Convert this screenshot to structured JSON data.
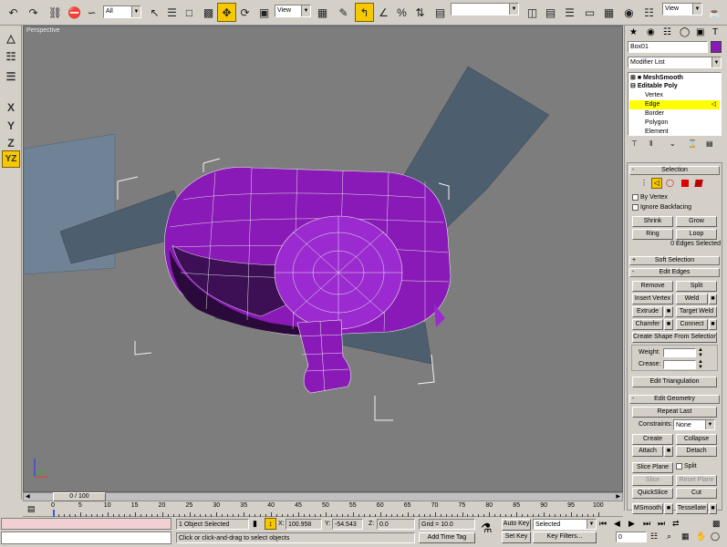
{
  "toolbar": {
    "selection_filter": "All",
    "ref_coord": "View",
    "named_selection": "",
    "view_dropdown": "View"
  },
  "viewport": {
    "label": "Perspective"
  },
  "left_toolbar": {
    "x_label": "X",
    "y_label": "Y",
    "z_label": "Z",
    "yz_label": "YZ"
  },
  "panel": {
    "object_name": "Box01",
    "object_color": "#8a1ab8",
    "modifier_list": "Modifier List",
    "stack": {
      "meshsmooth": "MeshSmooth",
      "editable_poly": "Editable Poly",
      "subs": [
        "Vertex",
        "Edge",
        "Border",
        "Polygon",
        "Element"
      ],
      "selected_sub": "Edge"
    },
    "selection": {
      "title": "Selection",
      "by_vertex": "By Vertex",
      "ignore_backfacing": "Ignore Backfacing",
      "shrink": "Shrink",
      "grow": "Grow",
      "ring": "Ring",
      "loop": "Loop",
      "status": "0 Edges Selected"
    },
    "soft_selection": "Soft Selection",
    "edit_edges": {
      "title": "Edit Edges",
      "remove": "Remove",
      "split": "Split",
      "insert_vertex": "Insert Vertex",
      "weld": "Weld",
      "extrude": "Extrude",
      "target_weld": "Target Weld",
      "chamfer": "Chamfer",
      "connect": "Connect",
      "create_shape": "Create Shape From Selection",
      "weight_label": "Weight:",
      "crease_label": "Crease:",
      "edit_triangulation": "Edit Triangulation"
    },
    "edit_geometry": {
      "title": "Edit Geometry",
      "repeat_last": "Repeat Last",
      "constraints_label": "Constraints:",
      "constraints_value": "None",
      "create": "Create",
      "collapse": "Collapse",
      "attach": "Attach",
      "detach": "Detach",
      "slice_plane": "Slice Plane",
      "split": "Split",
      "slice": "Slice",
      "reset_plane": "Reset Plane",
      "quickslice": "QuickSlice",
      "cut": "Cut",
      "msmooth": "MSmooth",
      "tessellate": "Tessellate"
    }
  },
  "timeline": {
    "frame_display": "0 / 100",
    "ticks": [
      "0",
      "5",
      "10",
      "15",
      "20",
      "25",
      "30",
      "35",
      "40",
      "45",
      "50",
      "55",
      "60",
      "65",
      "70",
      "75",
      "80",
      "85",
      "90",
      "95",
      "100"
    ]
  },
  "status": {
    "objects_selected": "1 Object Selected",
    "prompt": "Click or click-and-drag to select objects",
    "x_label": "X:",
    "x_value": "100.958",
    "y_label": "Y:",
    "y_value": "-54.543",
    "z_label": "Z:",
    "z_value": "0.0",
    "grid": "Grid = 10.0",
    "add_time_tag": "Add Time Tag",
    "auto_key": "Auto Key",
    "set_key": "Set Key",
    "key_mode": "Selected",
    "key_filters": "Key Filters...",
    "frame": "0"
  }
}
